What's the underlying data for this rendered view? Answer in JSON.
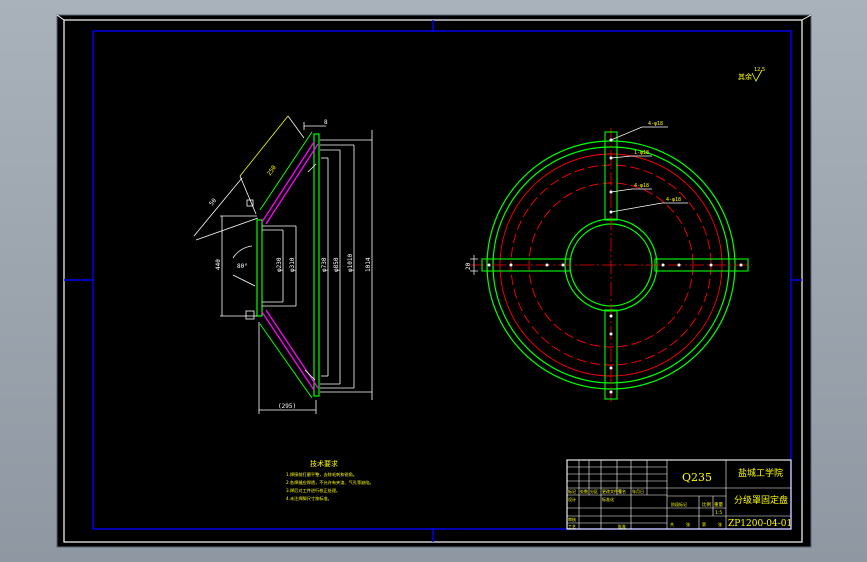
{
  "colors": {
    "background": "#000000",
    "viewport": "#9aa3ad",
    "border": "#0000ff",
    "part": "#00ff00",
    "dimension": "#ffffff",
    "annotation": "#ffff00",
    "centerline": "#ff0000"
  },
  "side_view": {
    "dims": {
      "top_offset": "8",
      "slant_length": "250",
      "slant_width": "50",
      "inner_dia_1": "φ230",
      "inner_dia_2": "φ310",
      "outer_dia_1": "φ730",
      "outer_dia_2": "φ850",
      "outer_dia_3": "φ1010",
      "overall": "1014",
      "left_height": "440",
      "bottom_width": "(295)",
      "angle": "80°"
    }
  },
  "plan_view": {
    "callouts": [
      "4-φ18",
      "1-φ18",
      "4-φ18",
      "4-φ18"
    ],
    "slot_label": "20"
  },
  "roughness": {
    "label": "其余",
    "value": "12.5"
  },
  "technical_requirements": {
    "title": "技术要求",
    "items": [
      "1.焊接前打磨平整，去除毛刺和锐角。",
      "2.各焊缝应焊透，不允许有夹渣、气孔等缺陷。",
      "3.焊后对工件进行校正处理。",
      "4.未注焊脚尺寸按标准。"
    ]
  },
  "title_block": {
    "material": "Q235",
    "school": "盐城工学院",
    "part_name": "分级罩固定盘",
    "drawing_no": "ZP1200-04-01",
    "scale_label": "比例",
    "scale_value": "1:5",
    "weight_label": "重量",
    "row_labels": [
      "标记",
      "处数",
      "分区",
      "更改文件号",
      "签名",
      "年月日"
    ],
    "row2_labels": [
      "设计",
      "标准化",
      "阶段标记"
    ],
    "row3_labels": [
      "审核",
      "工艺",
      "批准"
    ],
    "sheet_labels": [
      "共",
      "张",
      "第",
      "张"
    ]
  }
}
